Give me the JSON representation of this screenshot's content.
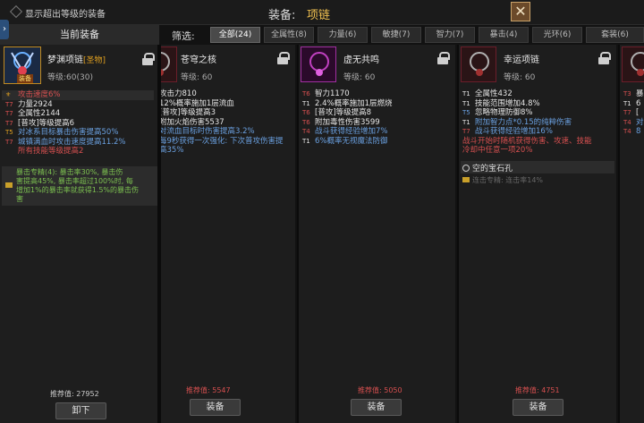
{
  "topbar": {
    "show_over_level": "显示超出等级的装备",
    "equip_label": "装备:",
    "equip_type": "项链",
    "close_symbol": "✕"
  },
  "current": {
    "header": "当前装备",
    "name": "梦渊项链",
    "grade": "[圣物]",
    "level": "等级:60(30)",
    "badge": "装备",
    "stats": [
      {
        "tier": "⚜",
        "text": "攻击速度6%",
        "color": "#d85050"
      },
      {
        "tier": "T7",
        "text": "力量2924",
        "color": "#e6e6e6"
      },
      {
        "tier": "T7",
        "text": "全属性2144",
        "color": "#e6e6e6"
      },
      {
        "tier": "T7",
        "text": "[普攻]等级提高6",
        "color": "#e6e6e6"
      },
      {
        "tier": "T5",
        "text": "对冰系目标暴击伤害提高50%",
        "color": "#6aa0e0"
      },
      {
        "tier": "T7",
        "text": "城镇满血时攻击速度提高11.2%",
        "color": "#6aa0e0"
      },
      {
        "tier": "",
        "text": "所有技能等级提高2",
        "color": "#d85050"
      }
    ],
    "set_text_1": "暴击专精(4): 暴击率30%, 暴击伤",
    "set_text_2": "害提高45%, 暴击率超过100%时, 每",
    "set_text_3": "增加1%的暴击率就获得1.5%的暴击伤",
    "set_text_4": "害",
    "recommend": "推荐值: 27952",
    "button": "卸下"
  },
  "filters": {
    "label": "筛选:",
    "tabs": [
      "全部(24)",
      "全属性(8)",
      "力量(6)",
      "敏捷(7)",
      "智力(7)",
      "暴击(4)",
      "光环(6)",
      "套装(6)"
    ]
  },
  "items": [
    {
      "name": "苍穹之核",
      "level": "等级: 60",
      "stats": [
        {
          "tier": "",
          "text": "攻击力810",
          "color": "#e6e6e6"
        },
        {
          "tier": "",
          "text": "12%概率施加1层流血",
          "color": "#e6e6e6"
        },
        {
          "tier": "",
          "text": "[普攻]等级提高3",
          "color": "#e6e6e6"
        },
        {
          "tier": "",
          "text": "附加火焰伤害5537",
          "color": "#e6e6e6"
        },
        {
          "tier": "",
          "text": "对流血目标时伤害提高3.2%",
          "color": "#6aa0e0"
        },
        {
          "tier": "",
          "text": "每9秒获得一次强化: 下次普攻伤害提",
          "color": "#6aa0e0"
        },
        {
          "tier": "",
          "text": "高35%",
          "color": "#6aa0e0"
        }
      ],
      "recommend": "推荐值: 5547",
      "button": "装备"
    },
    {
      "name": "虚无共鸣",
      "level": "等级: 60",
      "stats": [
        {
          "tier": "T6",
          "text": "智力1170",
          "color": "#e6e6e6"
        },
        {
          "tier": "T1",
          "text": "2.4%概率施加1层燃烧",
          "color": "#e6e6e6"
        },
        {
          "tier": "T6",
          "text": "[普攻]等级提高8",
          "color": "#e6e6e6"
        },
        {
          "tier": "T6",
          "text": "附加毒性伤害3599",
          "color": "#e6e6e6"
        },
        {
          "tier": "T4",
          "text": "战斗获得经验增加7%",
          "color": "#6aa0e0"
        },
        {
          "tier": "T1",
          "text": "6%概率无视魔法防御",
          "color": "#6aa0e0"
        }
      ],
      "recommend": "推荐值: 5050",
      "button": "装备"
    },
    {
      "name": "幸运项链",
      "level": "等级: 60",
      "stats": [
        {
          "tier": "T1",
          "text": "全属性432",
          "color": "#e6e6e6"
        },
        {
          "tier": "T1",
          "text": "技能范围增加4.8%",
          "color": "#e6e6e6"
        },
        {
          "tier": "T5",
          "text": "忽略物理防御8%",
          "color": "#e6e6e6"
        },
        {
          "tier": "T1",
          "text": "附加智力点*0.15的纯粹伤害",
          "color": "#6aa0e0"
        },
        {
          "tier": "T7",
          "text": "战斗获得经验增加16%",
          "color": "#6aa0e0"
        },
        {
          "tier": "",
          "text": "战斗开始时随机获得伤害、攻速、技能",
          "color": "#d85050"
        },
        {
          "tier": "",
          "text": "冷却中任意一项20%",
          "color": "#d85050"
        }
      ],
      "gem_slot": "空的宝石孔",
      "set_text": "连击专精: 连击率14%",
      "recommend": "推荐值: 4751",
      "button": "装备"
    },
    {
      "name": "",
      "level": "",
      "stats": [
        {
          "tier": "T3",
          "text": "暴",
          "color": "#e6e6e6"
        },
        {
          "tier": "T1",
          "text": "6",
          "color": "#e6e6e6"
        },
        {
          "tier": "T7",
          "text": "[",
          "color": "#e6e6e6"
        },
        {
          "tier": "T4",
          "text": "对",
          "color": "#6aa0e0"
        },
        {
          "tier": "T4",
          "text": "8",
          "color": "#6aa0e0"
        }
      ]
    }
  ]
}
